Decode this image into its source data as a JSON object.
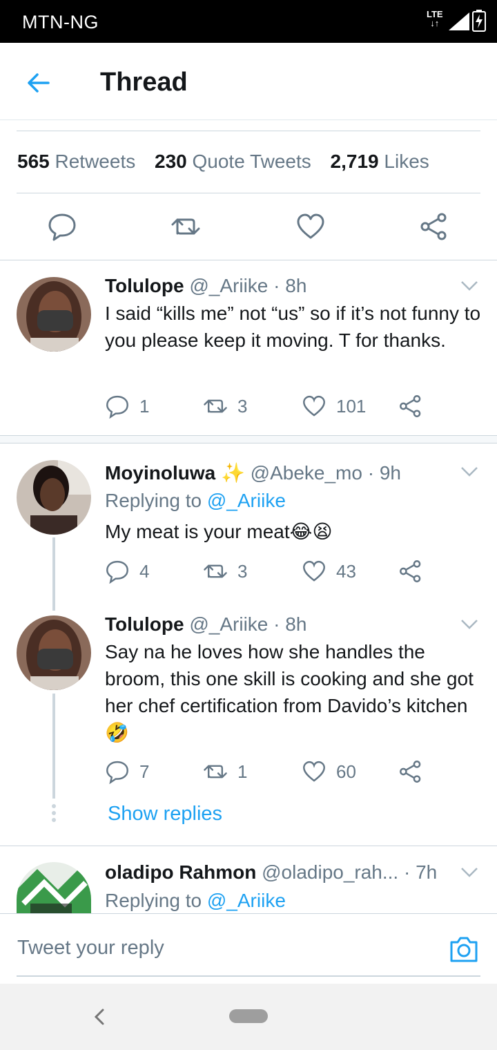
{
  "status_bar": {
    "carrier": "MTN-NG",
    "network": "LTE"
  },
  "header": {
    "title": "Thread"
  },
  "stats": [
    {
      "count": "565",
      "label": "Retweets"
    },
    {
      "count": "230",
      "label": "Quote Tweets"
    },
    {
      "count": "2,719",
      "label": "Likes"
    }
  ],
  "tweets": [
    {
      "name": "Tolulope",
      "handle": "@_Ariike",
      "time": "· 8h",
      "text": "I said “kills me” not “us” so if it’s not funny to you please keep it moving. T for thanks.",
      "replies": "1",
      "retweets": "3",
      "likes": "101"
    },
    {
      "name": "Moyinoluwa",
      "badge": "✨",
      "handle": "@Abeke_mo",
      "time": "· 9h",
      "replying_label": "Replying to",
      "replying_handle": "@_Ariike",
      "text": "My meat is your meat😂😫",
      "replies": "4",
      "retweets": "3",
      "likes": "43"
    },
    {
      "name": "Tolulope",
      "handle": "@_Ariike",
      "time": "· 8h",
      "text": "Say na he loves how she handles the broom, this one skill is cooking and she got her chef certification from Davido’s kitchen 🤣",
      "replies": "7",
      "retweets": "1",
      "likes": "60"
    },
    {
      "name": "oladipo Rahmon",
      "handle": "@oladipo_rah...",
      "time": "· 7h",
      "replying_label": "Replying to",
      "replying_handle": "@_Ariike"
    }
  ],
  "show_replies": "Show replies",
  "reply_bar": {
    "placeholder": "Tweet your reply"
  },
  "colors": {
    "accent": "#1da1f2",
    "muted": "#657786",
    "text": "#14171a",
    "border": "#ccd6dd"
  }
}
